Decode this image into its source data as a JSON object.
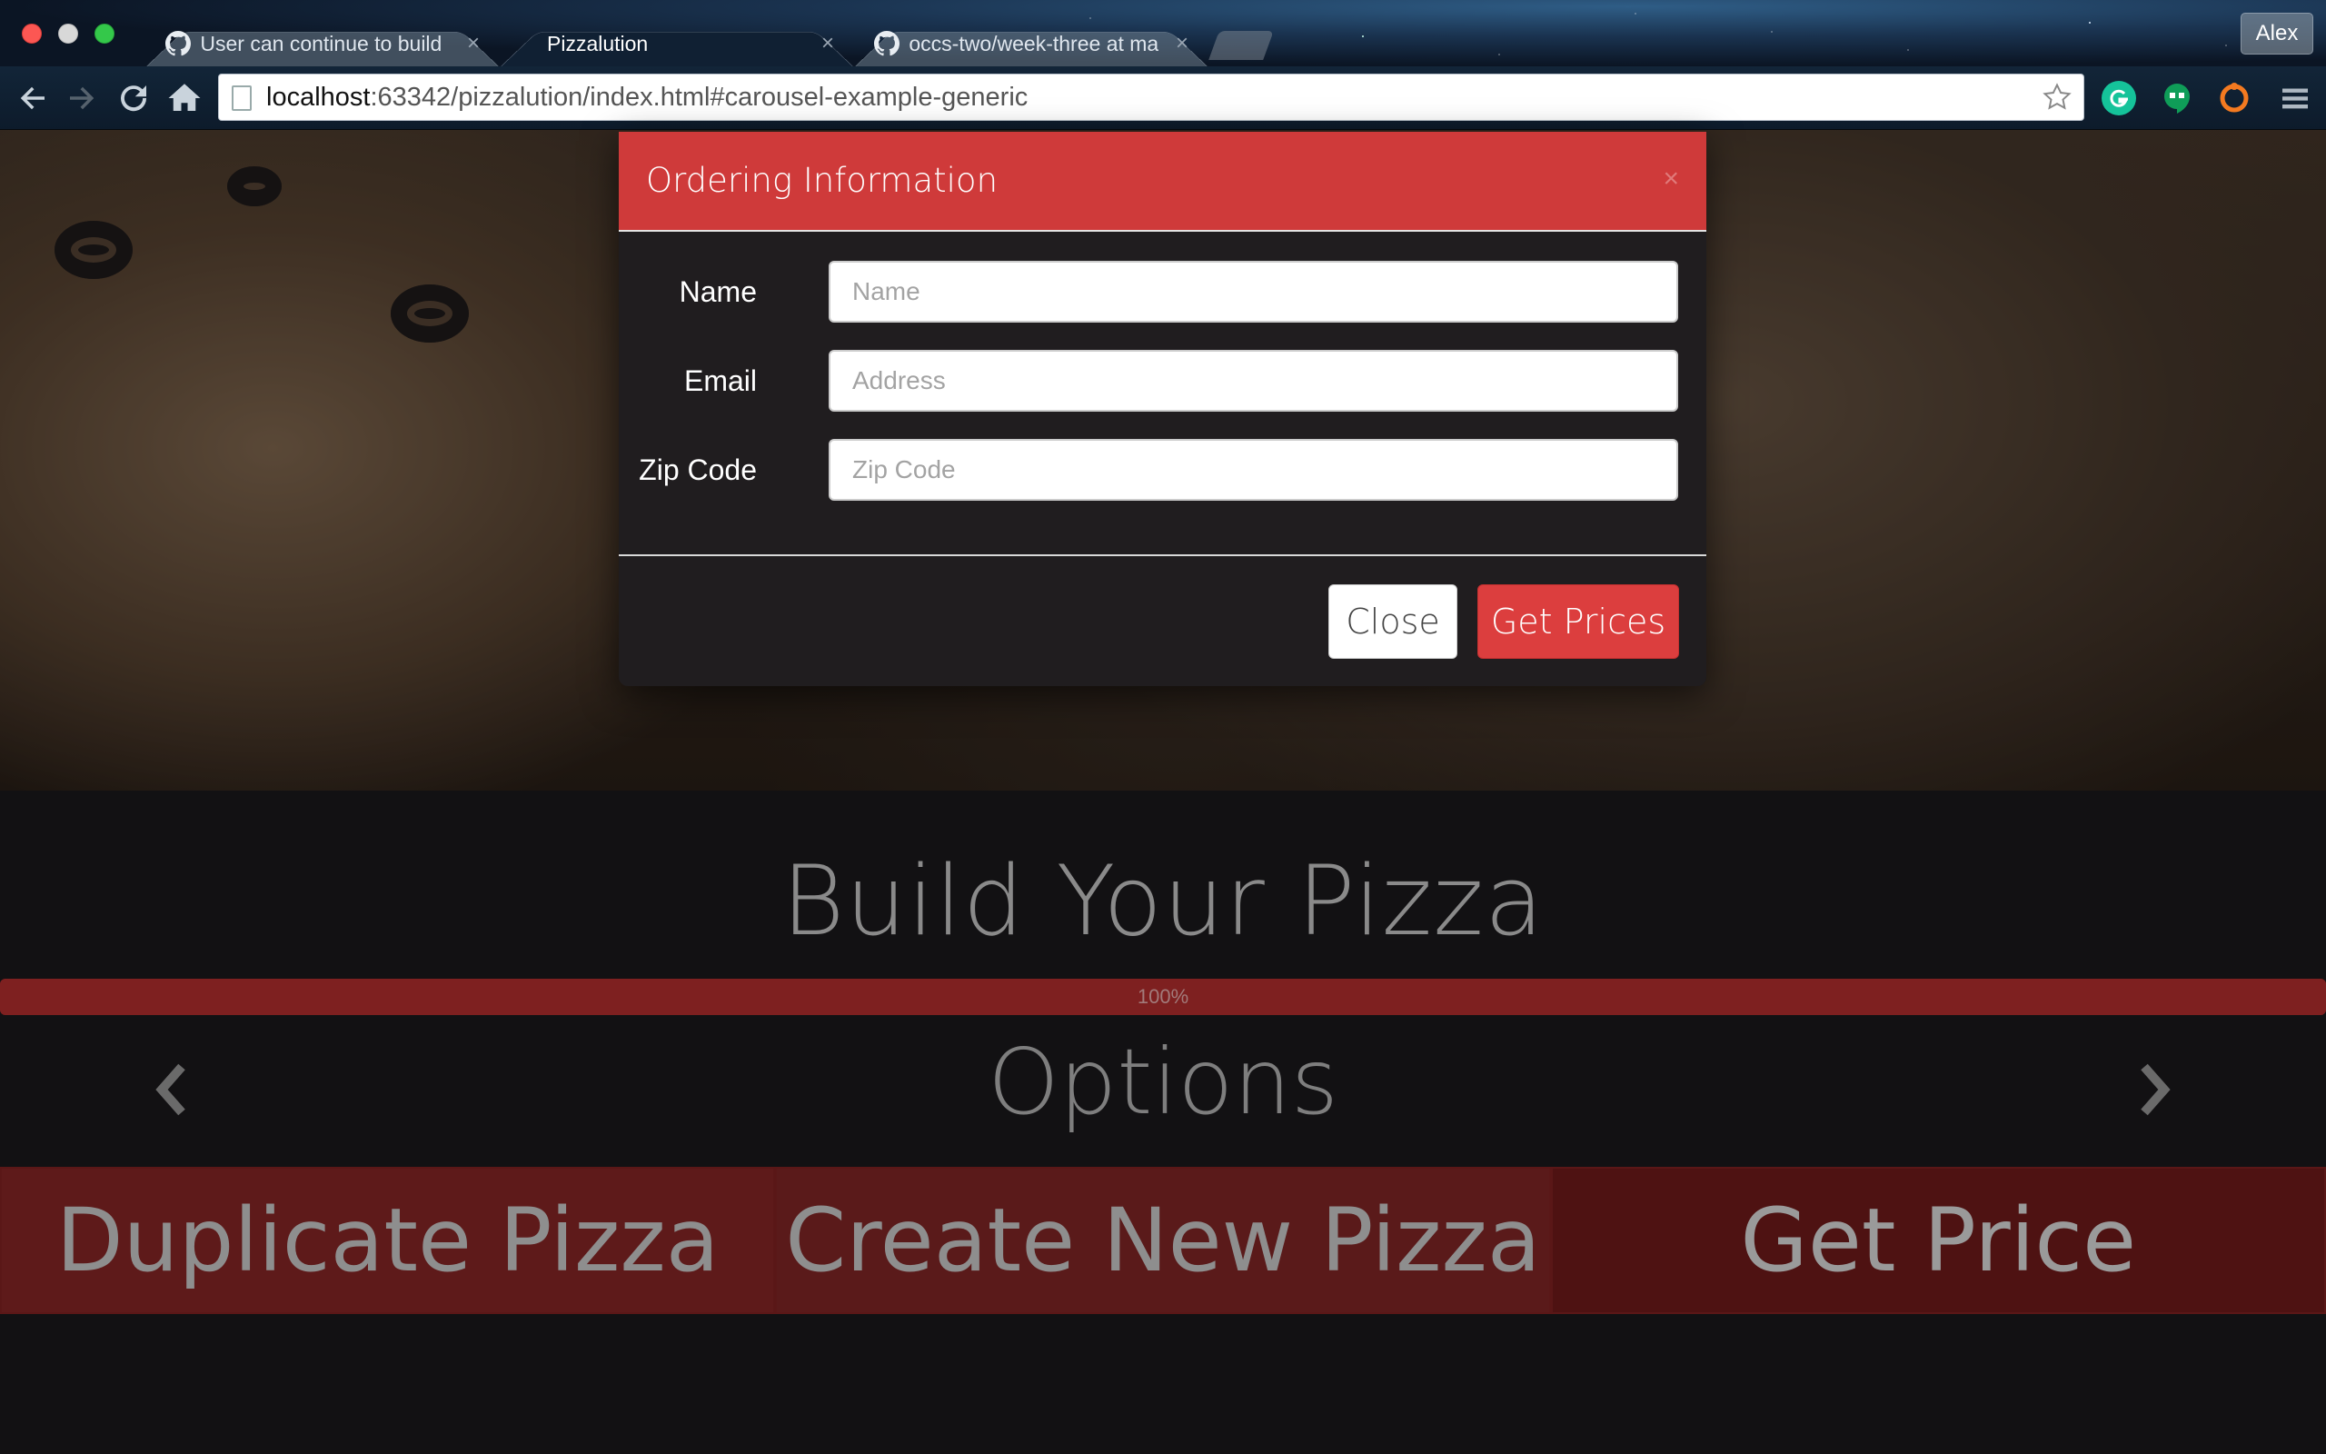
{
  "browser": {
    "tabs": [
      {
        "label": "User can continue to build",
        "icon": "github-icon"
      },
      {
        "label": "Pizzalution",
        "icon": ""
      },
      {
        "label": "occs-two/week-three at ma",
        "icon": "github-icon"
      }
    ],
    "tab_close_glyph": "×",
    "user_name": "Alex",
    "url_host": "localhost",
    "url_rest": ":63342/pizzalution/index.html#carousel-example-generic"
  },
  "page": {
    "build_title": "Build Your Pizza",
    "progress": {
      "value": 1.0,
      "label": "100%"
    },
    "options_title": "Options",
    "actions": [
      {
        "label": "Duplicate Pizza"
      },
      {
        "label": "Create New Pizza"
      },
      {
        "label": "Get Price"
      }
    ]
  },
  "modal": {
    "title": "Ordering Information",
    "close_glyph": "×",
    "fields": [
      {
        "label": "Name",
        "placeholder": "Name",
        "value": ""
      },
      {
        "label": "Email",
        "placeholder": "Address",
        "value": ""
      },
      {
        "label": "Zip Code",
        "placeholder": "Zip Code",
        "value": ""
      }
    ],
    "close_button": "Close",
    "submit_button": "Get Prices"
  },
  "colors": {
    "accent_red": "#cf3a3a",
    "button_red": "#dc3e3e",
    "dark_bg": "#121113",
    "modal_bg": "#201d1f"
  }
}
